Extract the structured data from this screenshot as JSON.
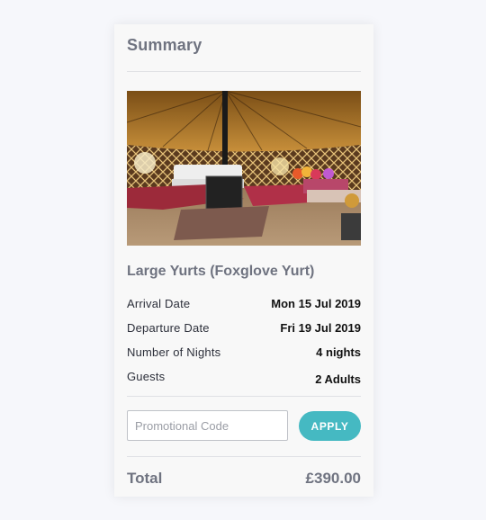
{
  "summary": {
    "title": "Summary",
    "property_name": "Large Yurts (Foxglove Yurt)",
    "image_alt": "yurt-interior-photo",
    "details": [
      {
        "label": "Arrival Date",
        "value": "Mon 15 Jul 2019"
      },
      {
        "label": "Departure Date",
        "value": "Fri 19 Jul 2019"
      },
      {
        "label": "Number of Nights",
        "value": "4 nights"
      },
      {
        "label": "Guests",
        "value": "2 Adults"
      }
    ],
    "promo": {
      "placeholder": "Promotional Code",
      "value": ""
    },
    "apply_label": "APPLY",
    "total_label": "Total",
    "total_value": "£390.00"
  },
  "colors": {
    "accent": "#45b9c2",
    "heading": "#6f7380",
    "background": "#f6f7fb",
    "card": "#f8f8f8"
  }
}
